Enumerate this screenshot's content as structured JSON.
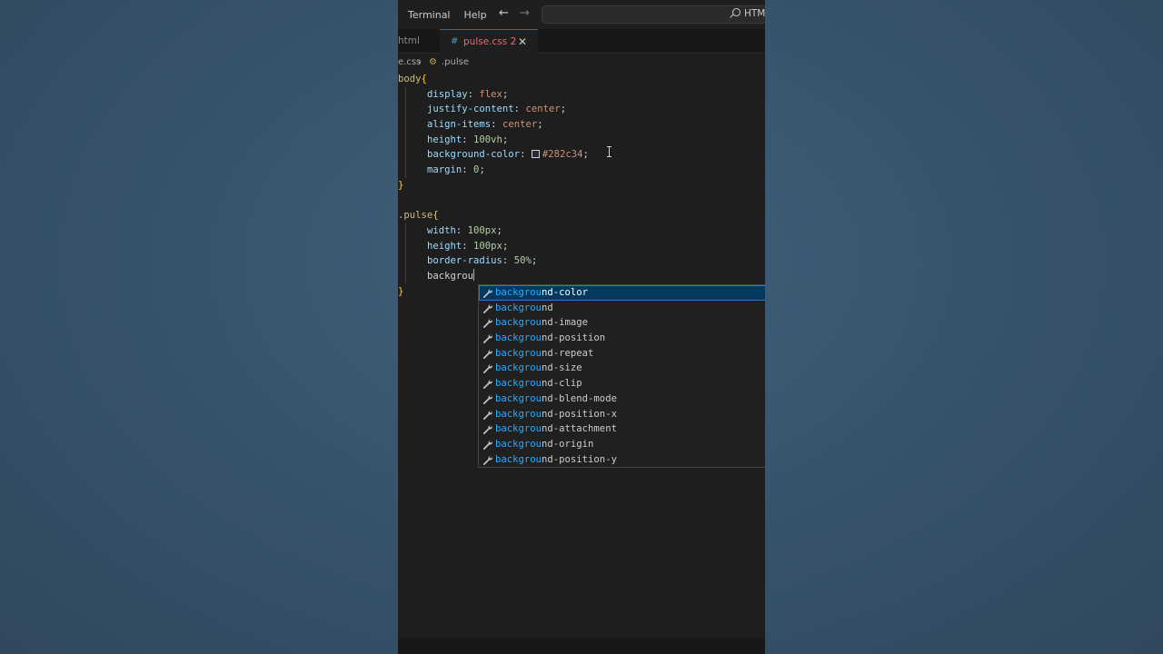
{
  "menu": [
    "Terminal",
    "Help"
  ],
  "search": {
    "text": "HTM"
  },
  "tabs": {
    "inactive": "html",
    "active": "pulse.css",
    "active_badge": "2"
  },
  "breadcrumb": {
    "file": "e.css",
    "selector": ".pulse"
  },
  "code": {
    "body_selector": "body",
    "display_prop": "display",
    "display_val": "flex",
    "justify_prop": "justify-content",
    "justify_val": "center",
    "align_prop": "align-items",
    "align_val": "center",
    "height_prop": "height",
    "height_val": "100vh",
    "bg_prop": "background-color",
    "bg_val": "#282c34",
    "margin_prop": "margin",
    "margin_val": "0",
    "pulse_selector": ".pulse",
    "width_prop": "width",
    "width_val": "100px",
    "height2_prop": "height",
    "height2_val": "100px",
    "radius_prop": "border-radius",
    "radius_val": "50%",
    "typed": "backgrou"
  },
  "suggestions": {
    "match": "backgrou",
    "items": [
      "nd-color",
      "nd",
      "nd-image",
      "nd-position",
      "nd-repeat",
      "nd-size",
      "nd-clip",
      "nd-blend-mode",
      "nd-position-x",
      "nd-attachment",
      "nd-origin",
      "nd-position-y"
    ]
  },
  "colors": {
    "swatch": "#282c34",
    "accent": "#0078d4",
    "match": "#2aaaff"
  }
}
